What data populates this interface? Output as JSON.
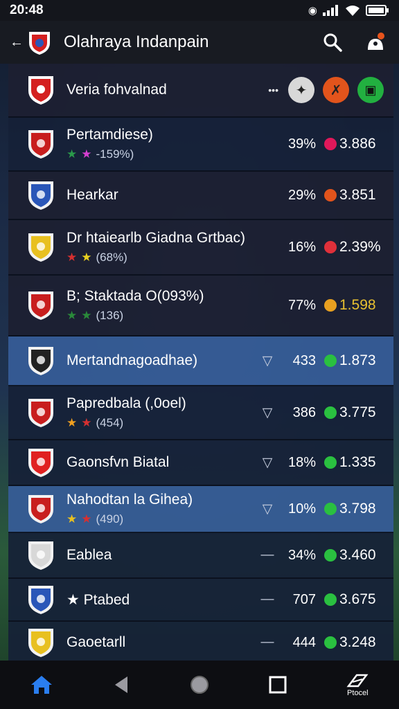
{
  "status": {
    "time": "20:48"
  },
  "app": {
    "title": "Olahraya Indanpain"
  },
  "header_row": {
    "name": "Veria fohvalnad",
    "more": "•••"
  },
  "rows": [
    {
      "name": "Pertamdiese)",
      "sub": "-159%)",
      "stars": [
        "★",
        "★"
      ],
      "star_colors": [
        "#2a9a4a",
        "#d63fd0"
      ],
      "trend": "",
      "pct": "39%",
      "odds": "3.886",
      "dot": "#e0185a",
      "odds_color": "#ffffff",
      "style": "normal",
      "crest": "#c81e1e"
    },
    {
      "name": "Hearkar",
      "sub": "",
      "stars": [],
      "star_colors": [],
      "trend": "",
      "pct": "29%",
      "odds": "3.851",
      "dot": "#e2541c",
      "odds_color": "#ffffff",
      "style": "dark",
      "crest": "#2a56b8"
    },
    {
      "name": "Dr htaiearlb Giadna Grtbac)",
      "sub": "(68%)",
      "stars": [
        "★",
        "★"
      ],
      "star_colors": [
        "#d63030",
        "#e8d020"
      ],
      "trend": "",
      "pct": "16%",
      "odds": "2.39%",
      "dot": "#e0303a",
      "odds_color": "#ffffff",
      "style": "dark",
      "crest": "#e8c020"
    },
    {
      "name": "B; Staktada O(093%)",
      "sub": "(136)",
      "stars": [
        "★",
        "★"
      ],
      "star_colors": [
        "#2a8a3a",
        "#2a8a3a"
      ],
      "trend": "",
      "pct": "77%",
      "odds": "1.598",
      "dot": "#e8a020",
      "odds_color": "#e8c030",
      "style": "dark",
      "crest": "#c81e1e"
    },
    {
      "name": "Mertandnagoadhae)",
      "sub": "",
      "stars": [],
      "star_colors": [],
      "trend": "▽",
      "pct": "433",
      "odds": "1.873",
      "dot": "#2ac040",
      "odds_color": "#ffffff",
      "style": "hl",
      "crest": "#222"
    },
    {
      "name": "Papredbala (,0oel)",
      "sub": "(454)",
      "stars": [
        "★",
        "★"
      ],
      "star_colors": [
        "#f0a020",
        "#d63030"
      ],
      "trend": "▽",
      "pct": "386",
      "odds": "3.775",
      "dot": "#2ac040",
      "odds_color": "#ffffff",
      "style": "normal",
      "crest": "#c81e1e"
    },
    {
      "name": "Gaonsfvn Biatal",
      "sub": "",
      "stars": [],
      "star_colors": [],
      "trend": "▽",
      "pct": "18%",
      "odds": "1.335",
      "dot": "#2ac040",
      "odds_color": "#ffffff",
      "style": "normal",
      "crest": "#e02020"
    },
    {
      "name": "Nahodtan la Gihea)",
      "sub": "(490)",
      "stars": [
        "★",
        "★"
      ],
      "star_colors": [
        "#e8c020",
        "#d63030"
      ],
      "trend": "▽",
      "pct": "10%",
      "odds": "3.798",
      "dot": "#2ac040",
      "odds_color": "#ffffff",
      "style": "hl",
      "crest": "#c81e1e"
    },
    {
      "name": "Eablea",
      "sub": "",
      "stars": [],
      "star_colors": [],
      "trend": "—",
      "pct": "34%",
      "odds": "3.460",
      "dot": "#2ac040",
      "odds_color": "#ffffff",
      "style": "normal",
      "crest": "#d8d8d8"
    },
    {
      "name": "★ Ptabed",
      "sub": "",
      "stars": [],
      "star_colors": [],
      "trend": "—",
      "pct": "707",
      "odds": "3.675",
      "dot": "#2ac040",
      "odds_color": "#ffffff",
      "style": "normal",
      "crest": "#2a56b8"
    },
    {
      "name": "Gaoetarll",
      "sub": "",
      "stars": [],
      "star_colors": [],
      "trend": "—",
      "pct": "444",
      "odds": "3.248",
      "dot": "#2ac040",
      "odds_color": "#ffffff",
      "style": "normal",
      "crest": "#e8c020"
    }
  ],
  "nav": {
    "last_label": "Ptocel"
  }
}
